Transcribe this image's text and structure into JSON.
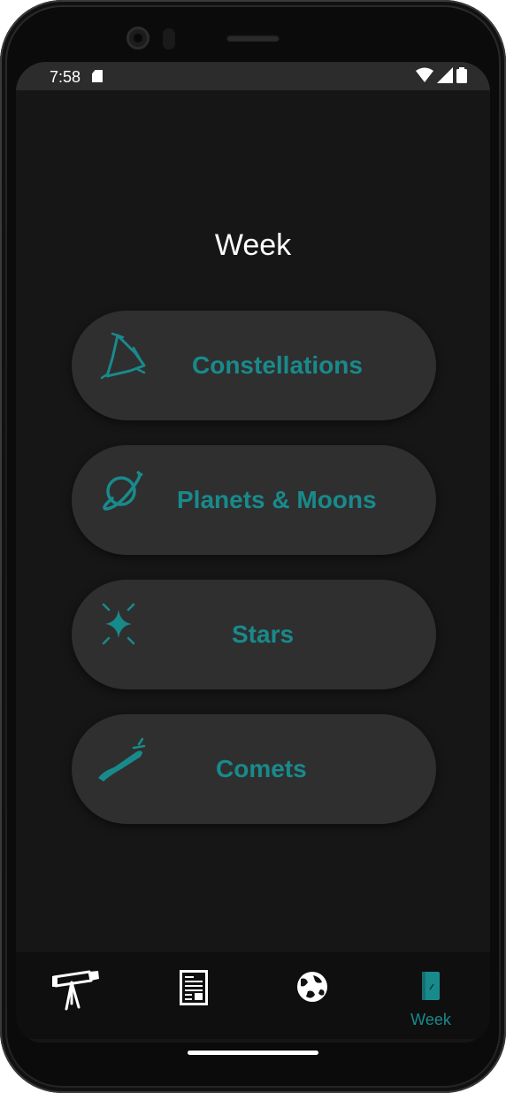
{
  "status_bar": {
    "time": "7:58"
  },
  "screen": {
    "title": "Week"
  },
  "categories": [
    {
      "label": "Constellations",
      "icon": "constellation-icon"
    },
    {
      "label": "Planets & Moons",
      "icon": "planet-icon"
    },
    {
      "label": "Stars",
      "icon": "star-sparkle-icon"
    },
    {
      "label": "Comets",
      "icon": "comet-icon"
    }
  ],
  "nav": {
    "items": [
      {
        "icon": "telescope-icon",
        "label": ""
      },
      {
        "icon": "newspaper-icon",
        "label": ""
      },
      {
        "icon": "globe-icon",
        "label": ""
      },
      {
        "icon": "book-icon",
        "label": "Week"
      }
    ]
  },
  "colors": {
    "accent": "#198a8c",
    "background": "#161616",
    "button": "#2f2f2f",
    "nav_background": "#0f0f0f"
  }
}
